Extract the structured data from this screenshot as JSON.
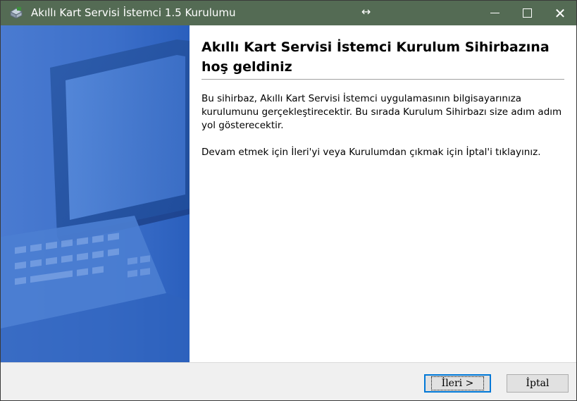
{
  "window": {
    "title": "Akıllı Kart Servisi İstemci 1.5 Kurulumu",
    "icons": {
      "app": "installer-box-icon",
      "resize": "resize-horizontal-cursor-icon",
      "minimize": "minimize-icon",
      "maximize": "maximize-icon",
      "close": "close-icon"
    },
    "resize_glyph": "↔",
    "close_glyph": "✕"
  },
  "sidebar": {
    "image": "computer-monitor-keyboard-illustration"
  },
  "content": {
    "heading": "Akıllı Kart Servisi İstemci Kurulum Sihirbazına hoş geldiniz",
    "paragraph1": "Bu sihirbaz, Akıllı Kart Servisi İstemci uygulamasının bilgisayarınıza kurulumunu gerçekleştirecektir. Bu sırada Kurulum Sihirbazı size adım adım yol gösterecektir.",
    "paragraph2": "Devam etmek için İleri'yi veya Kurulumdan çıkmak için İptal'i tıklayınız."
  },
  "footer": {
    "next_label": "İleri >",
    "cancel_label": "İptal"
  },
  "colors": {
    "titlebar": "#546b54",
    "sidebar": "#3c6fc9",
    "focus_border": "#0078d7"
  }
}
